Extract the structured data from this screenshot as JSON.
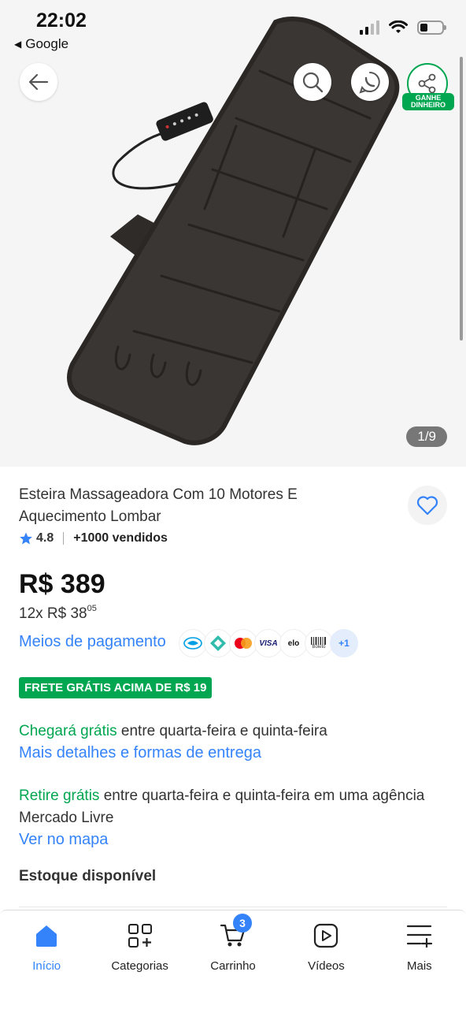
{
  "status_bar": {
    "time": "22:02",
    "back_app": "Google"
  },
  "gallery": {
    "counter": "1/9",
    "share_tag": "GANHE DINHEIRO"
  },
  "product": {
    "title": "Esteira Massageadora Com 10 Motores E Aquecimento Lombar",
    "rating": "4.8",
    "sold": "+1000 vendidos",
    "price": "R$ 389",
    "installments_prefix": "12x R$ 38",
    "installments_cents": "05"
  },
  "payment": {
    "link": "Meios de pagamento",
    "icons": [
      "mercadopago-icon",
      "pix-icon",
      "mastercard-icon",
      "visa-icon",
      "elo-icon",
      "boleto-icon"
    ],
    "visa_text": "VISA",
    "elo_text": "elo",
    "boleto_text": "Boleto",
    "more": "+1"
  },
  "shipping": {
    "badge": "FRETE GRÁTIS ACIMA DE R$ 19",
    "arrive_strong": "Chegará grátis",
    "arrive_rest": " entre quarta-feira e quinta-feira",
    "details_link": "Mais detalhes e formas de entrega",
    "pickup_strong": "Retire grátis",
    "pickup_rest": " entre quarta-feira e quinta-feira em uma agência Mercado Livre",
    "map_link": "Ver no mapa"
  },
  "stock": "Estoque disponível",
  "tabs": [
    {
      "label": "Início",
      "icon": "home-icon"
    },
    {
      "label": "Categorias",
      "icon": "categories-icon"
    },
    {
      "label": "Carrinho",
      "icon": "cart-icon",
      "badge": "3"
    },
    {
      "label": "Vídeos",
      "icon": "video-icon"
    },
    {
      "label": "Mais",
      "icon": "more-icon"
    }
  ],
  "colors": {
    "accent": "#3483fa",
    "green": "#00a650"
  }
}
